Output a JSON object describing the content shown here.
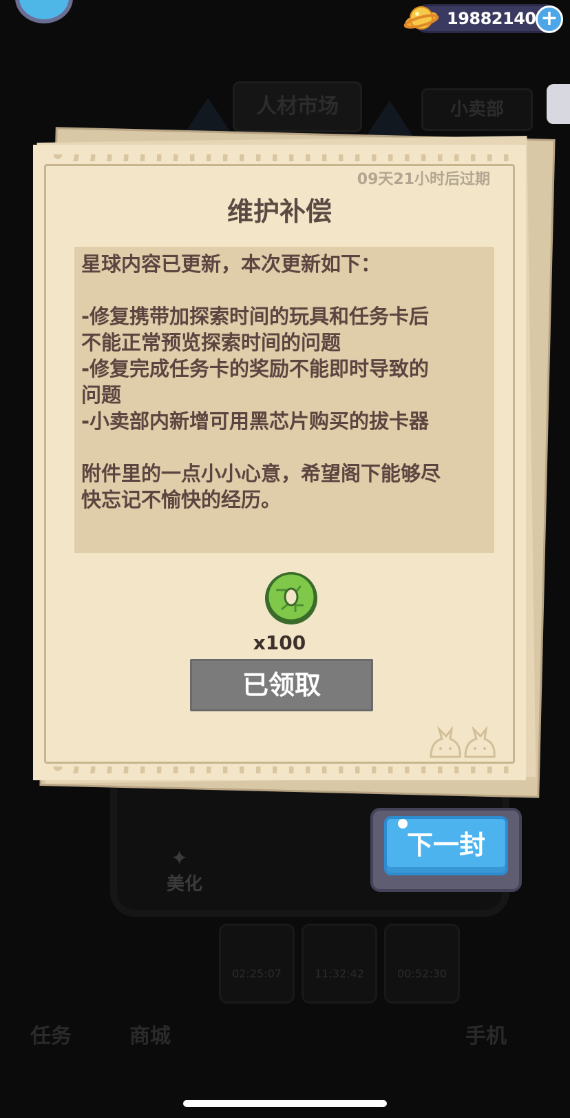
{
  "hud": {
    "currency_amount": "198821404",
    "currency_icon": "planet-coin-icon",
    "add_icon": "plus-icon"
  },
  "background": {
    "talent_market": "人材市场",
    "snack_shop": "小卖部",
    "beautify": "美化",
    "nav_tasks": "任务",
    "nav_store": "商城",
    "nav_phone": "手机",
    "timer_1": "02:25:07",
    "timer_2": "11:32:42",
    "timer_3": "00:52:30"
  },
  "letter": {
    "expire": "09天21小时后过期",
    "title": "维护补偿",
    "body_lines": [
      "星球内容已更新，本次更新如下：",
      "",
      "-修复携带加探索时间的玩具和任务卡后",
      "不能正常预览探索时间的问题",
      "-修复完成任务卡的奖励不能即时导致的",
      "问题",
      "-小卖部内新增可用黑芯片购买的拔卡器",
      "",
      "附件里的一点小小心意，希望阁下能够尽",
      "快忘记不愉快的经历。"
    ],
    "reward_icon": "green-chip-icon",
    "reward_quantity": "x100",
    "claimed_label": "已领取"
  },
  "actions": {
    "next_label": "下一封"
  },
  "colors": {
    "paper": "#f3e6c8",
    "body_box": "#e0cdaa",
    "text": "#5c4540",
    "button_claimed": "#7b7b7b",
    "button_next": "#4db3ee"
  }
}
